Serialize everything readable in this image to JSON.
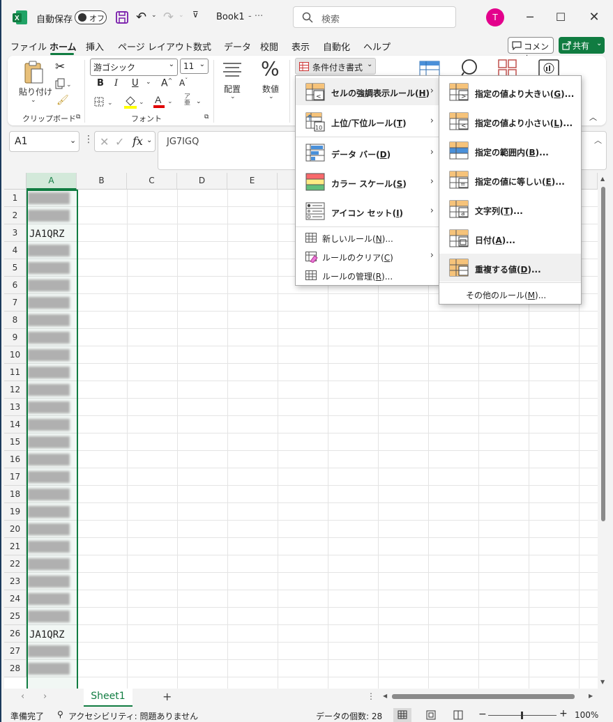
{
  "titlebar": {
    "autosave_label": "自動保存",
    "toggle_state": "オフ",
    "filename": "Book1",
    "filename_suffix": "-  ···",
    "search_placeholder": "検索",
    "user_initial": "T"
  },
  "tabs": [
    "ファイル",
    "ホーム",
    "挿入",
    "ページ レイアウト",
    "数式",
    "データ",
    "校閲",
    "表示",
    "自動化",
    "ヘルプ"
  ],
  "comment_label": "コメント",
  "share_label": "共有",
  "ribbon": {
    "paste_label": "貼り付け",
    "clipboard_group": "クリップボード",
    "font_name": "游ゴシック",
    "font_size": "11",
    "font_group": "フォント",
    "align_label": "配置",
    "number_label": "数値",
    "cond_format_label": "条件付き書式"
  },
  "formula": {
    "namebox": "A1",
    "fx": "fx",
    "content": "JG7IGQ"
  },
  "columns": [
    "A",
    "B",
    "C",
    "D",
    "E"
  ],
  "rows": [
    "1",
    "2",
    "3",
    "4",
    "5",
    "6",
    "7",
    "8",
    "9",
    "10",
    "11",
    "12",
    "13",
    "14",
    "15",
    "16",
    "17",
    "18",
    "19",
    "20",
    "21",
    "22",
    "23",
    "24",
    "25",
    "26",
    "27",
    "28"
  ],
  "cells": {
    "a3": "JA1QRZ",
    "a26": "JA1QRZ"
  },
  "cond_menu": {
    "items": [
      {
        "label": "セルの強調表示ルール(",
        "key": "H",
        "end": ")"
      },
      {
        "label": "上位/下位ルール(",
        "key": "T",
        "end": ")"
      },
      {
        "label": "データ バー(",
        "key": "D",
        "end": ")"
      },
      {
        "label": "カラー スケール(",
        "key": "S",
        "end": ")"
      },
      {
        "label": "アイコン セット(",
        "key": "I",
        "end": ")"
      }
    ],
    "sub_items": [
      {
        "label": "新しいルール(",
        "key": "N",
        "end": ")..."
      },
      {
        "label": "ルールのクリア(",
        "key": "C",
        "end": ")"
      },
      {
        "label": "ルールの管理(",
        "key": "R",
        "end": ")..."
      }
    ]
  },
  "highlight_menu": {
    "items": [
      {
        "label": "指定の値より大きい(",
        "key": "G",
        "end": ")..."
      },
      {
        "label": "指定の値より小さい(",
        "key": "L",
        "end": ")..."
      },
      {
        "label": "指定の範囲内(",
        "key": "B",
        "end": ")..."
      },
      {
        "label": "指定の値に等しい(",
        "key": "E",
        "end": ")..."
      },
      {
        "label": "文字列(",
        "key": "T",
        "end": ")..."
      },
      {
        "label": "日付(",
        "key": "A",
        "end": ")..."
      },
      {
        "label": "重複する値(",
        "key": "D",
        "end": ")..."
      }
    ],
    "more": {
      "label": "その他のルール(",
      "key": "M",
      "end": ")..."
    }
  },
  "sheet_tab": "Sheet1",
  "status": {
    "ready": "準備完了",
    "accessibility": "アクセシビリティ: 問題ありません",
    "count": "データの個数: 28",
    "zoom": "100%"
  },
  "colors": {
    "accent": "#107c41",
    "avatar": "#e3008c"
  }
}
